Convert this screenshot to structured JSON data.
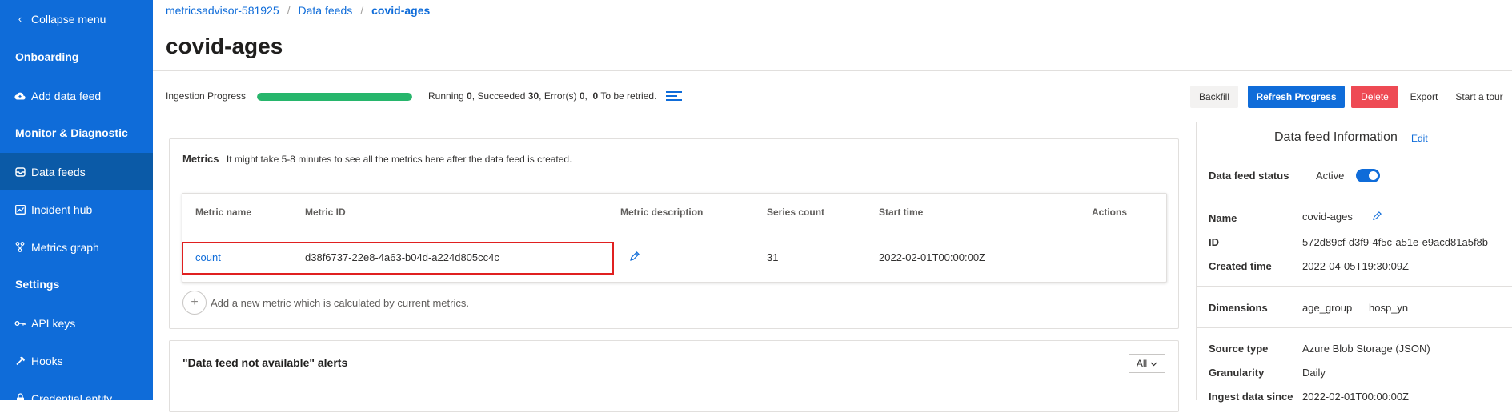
{
  "sidebar": {
    "collapse_label": "Collapse menu",
    "section_onboarding": "Onboarding",
    "add_data_feed": "Add data feed",
    "section_monitor": "Monitor & Diagnostic",
    "data_feeds": "Data feeds",
    "incident_hub": "Incident hub",
    "metrics_graph": "Metrics graph",
    "section_settings": "Settings",
    "api_keys": "API keys",
    "hooks": "Hooks",
    "credential_entity": "Credential entity"
  },
  "breadcrumb": {
    "root": "metricsadvisor-581925",
    "parent": "Data feeds",
    "current": "covid-ages",
    "separator": "/"
  },
  "page_title": "covid-ages",
  "ingestion": {
    "label": "Ingestion Progress",
    "progress_fraction": 1.0,
    "running_label": "Running",
    "running": "0",
    "succeeded_label": "Succeeded",
    "succeeded": "30",
    "errors_label": "Error(s)",
    "errors": "0",
    "retry_count": "0",
    "retry_label": "To be retried."
  },
  "toolbar": {
    "backfill": "Backfill",
    "refresh": "Refresh Progress",
    "delete": "Delete",
    "export": "Export",
    "tour": "Start a tour"
  },
  "metrics": {
    "title": "Metrics",
    "note": "It might take 5-8 minutes to see all the metrics here after the data feed is created.",
    "columns": [
      "Metric name",
      "Metric ID",
      "Metric description",
      "Series count",
      "Start time",
      "Actions"
    ],
    "rows": [
      {
        "name": "count",
        "id": "d38f6737-22e8-4a63-b04d-a224d805cc4c",
        "description": "",
        "series_count": "31",
        "start_time": "2022-02-01T00:00:00Z"
      }
    ],
    "add_text": "Add a new metric which is calculated by current metrics."
  },
  "alerts": {
    "title": "\"Data feed not available\" alerts",
    "filter_value": "All"
  },
  "info": {
    "title": "Data feed Information",
    "edit": "Edit",
    "status_label": "Data feed status",
    "status_value": "Active",
    "name_label": "Name",
    "name_value": "covid-ages",
    "id_label": "ID",
    "id_value": "572d89cf-d3f9-4f5c-a51e-e9acd81a5f8b",
    "created_label": "Created time",
    "created_value": "2022-04-05T19:30:09Z",
    "dimensions_label": "Dimensions",
    "dimension_1": "age_group",
    "dimension_2": "hosp_yn",
    "source_label": "Source type",
    "source_value": "Azure Blob Storage (JSON)",
    "granularity_label": "Granularity",
    "granularity_value": "Daily",
    "ingest_label": "Ingest data since",
    "ingest_value": "2022-02-01T00:00:00Z"
  },
  "colors": {
    "accent": "#0f6cd9",
    "sidebar_active": "#0b5aa7",
    "progress": "#27b66c",
    "danger": "#ee4a54",
    "highlight": "#e02020"
  }
}
